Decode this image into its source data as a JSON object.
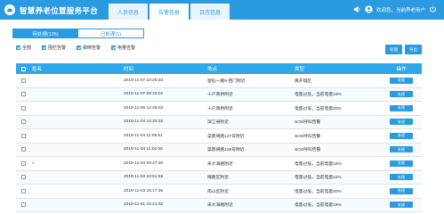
{
  "header": {
    "title": "智慧养老位置服务平台",
    "tabs": [
      {
        "label": "人员信息",
        "active": false
      },
      {
        "label": "告警信息",
        "active": true
      },
      {
        "label": "日志信息",
        "active": false
      }
    ],
    "user_text": "欢迎您，当前养老用户",
    "brand_color": "#2a9be0"
  },
  "subtabs": [
    {
      "label": "待处理(125)",
      "active": true
    },
    {
      "label": "已处理(1)",
      "active": false
    }
  ],
  "filters": [
    {
      "label": "全部",
      "checked": true
    },
    {
      "label": "围栏告警",
      "checked": true
    },
    {
      "label": "摔倒告警",
      "checked": true
    },
    {
      "label": "电量告警",
      "checked": true
    }
  ],
  "buttons": {
    "process": "处理",
    "export": "导出"
  },
  "table": {
    "columns": [
      "姓名",
      "时间",
      "地点",
      "类型",
      "操作"
    ],
    "rows": [
      {
        "name": "",
        "time": "2019-11-07 10:25:33",
        "location": "留仙一路8-西门附近",
        "type": "离开城区",
        "action": "处理"
      },
      {
        "name": "",
        "time": "2019-11-07 09:33:02",
        "location": "十户南桥附近",
        "type": "电量过低，当前电量19%",
        "action": "处理"
      },
      {
        "name": "",
        "time": "2019-11-06 12:48:02",
        "location": "十户南桥附近",
        "type": "电量过低，当前电量30%",
        "action": "处理"
      },
      {
        "name": "",
        "time": "2019-11-04 14:20:28",
        "location": "滨江县附近",
        "type": "SOS呼叫告警",
        "action": "处理"
      },
      {
        "name": "",
        "time": "2019-11-04 11:05:51",
        "location": "菜鼎闸路127号附近",
        "type": "SOS呼叫告警",
        "action": "处理"
      },
      {
        "name": "",
        "time": "2019-11-04 11:01:05",
        "location": "菜鼎闸路128号附近",
        "type": "SOS呼叫告警",
        "action": "处理"
      },
      {
        "name": "2",
        "time": "2019-11-04 09:47:36",
        "location": "采大海路附近",
        "type": "电量过低，当前电量18%",
        "action": "处理"
      },
      {
        "name": "",
        "time": "2019-11-03 10:51:55",
        "location": "梅路区附近",
        "type": "电量过低，当前电量15%",
        "action": "处理"
      },
      {
        "name": "",
        "time": "2019-11-03 16:17:35",
        "location": "南山区附近",
        "type": "电量过低，当前电量30%",
        "action": "处理"
      },
      {
        "name": "",
        "time": "2019-11-01 15:21:02",
        "location": "采大海路附近",
        "type": "电量过低，当前电量19%",
        "action": "处理"
      }
    ]
  }
}
